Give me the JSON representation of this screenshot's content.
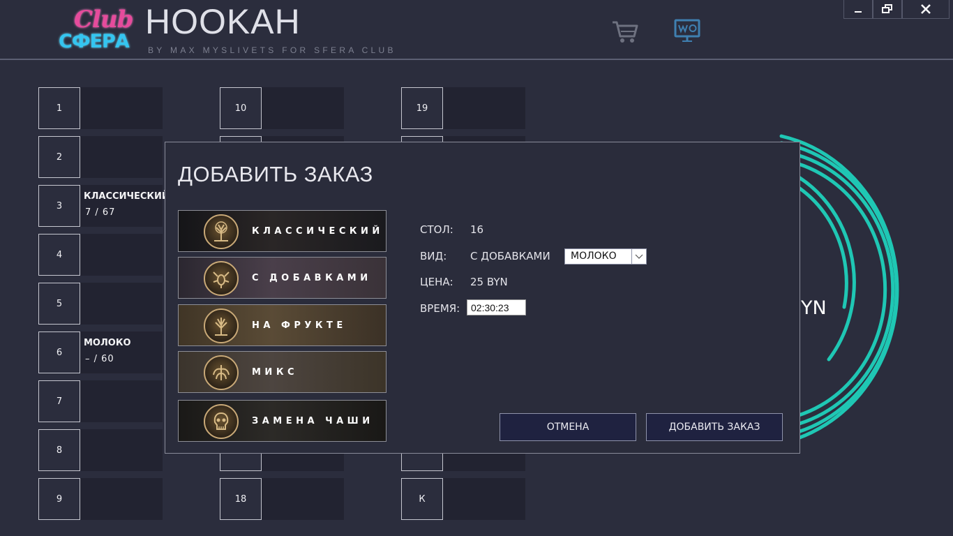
{
  "header": {
    "logo_top": "Club",
    "logo_bottom": "СФЕРА",
    "title": "HOOKAH",
    "subtitle": "BY MAX MYSLIVETS FOR SFERA CLUB",
    "icons": [
      "cart-icon",
      "monitor-icon"
    ]
  },
  "window": {
    "buttons": [
      "minimize-icon",
      "restore-icon",
      "close-icon"
    ]
  },
  "tables": [
    {
      "num": "1",
      "line1": "",
      "line2": ""
    },
    {
      "num": "2",
      "line1": "",
      "line2": ""
    },
    {
      "num": "3",
      "line1": "КЛАССИЧЕСКИЙ",
      "line2": "7 / 67"
    },
    {
      "num": "4",
      "line1": "",
      "line2": ""
    },
    {
      "num": "5",
      "line1": "",
      "line2": ""
    },
    {
      "num": "6",
      "line1": "МОЛОКО",
      "line2": "– / 60"
    },
    {
      "num": "7",
      "line1": "",
      "line2": ""
    },
    {
      "num": "8",
      "line1": "",
      "line2": ""
    },
    {
      "num": "9",
      "line1": "",
      "line2": ""
    },
    {
      "num": "10",
      "line1": "",
      "line2": ""
    },
    {
      "num": "18",
      "line1": "",
      "line2": ""
    },
    {
      "num": "19",
      "line1": "",
      "line2": ""
    },
    {
      "num": "К",
      "line1": "",
      "line2": ""
    }
  ],
  "ring": {
    "text": "YN",
    "color": "#1fc7b4"
  },
  "dialog": {
    "title": "ДОБАВИТЬ ЗАКАЗ",
    "options": [
      {
        "label": "КЛАССИЧЕСКИЙ",
        "icon": "tree-emblem-icon"
      },
      {
        "label": "С ДОБАВКАМИ",
        "icon": "scorpion-emblem-icon"
      },
      {
        "label": "НА ФРУКТЕ",
        "icon": "tree-emblem-icon"
      },
      {
        "label": "МИКС",
        "icon": "phoenix-emblem-icon"
      },
      {
        "label": "ЗАМЕНА ЧАШИ",
        "icon": "skull-emblem-icon"
      }
    ],
    "fields": {
      "table_label": "СТОЛ:",
      "table_value": "16",
      "kind_label": "ВИД:",
      "kind_value": "С ДОБАВКАМИ",
      "kind_select": "МОЛОКО",
      "price_label": "ЦЕНА:",
      "price_value": "25 BYN",
      "time_label": "ВРЕМЯ:",
      "time_value": "02:30:23"
    },
    "cancel": "ОТМЕНА",
    "submit": "ДОБАВИТЬ ЗАКАЗ"
  }
}
